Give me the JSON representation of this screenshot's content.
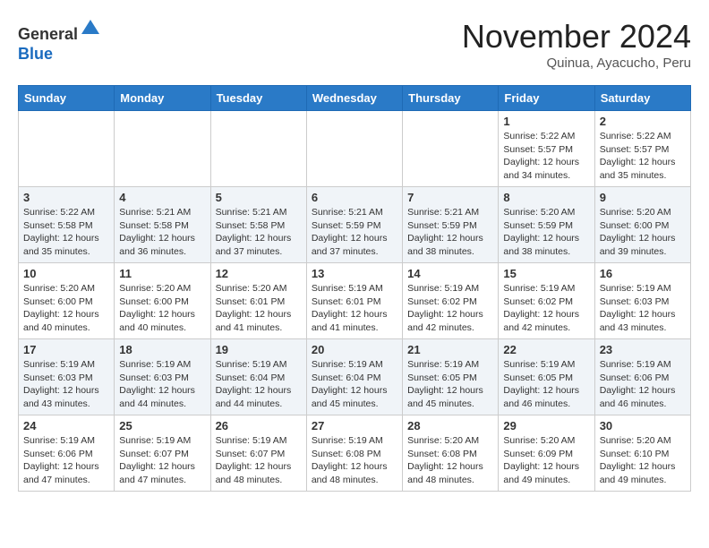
{
  "header": {
    "logo": {
      "line1": "General",
      "line2": "Blue"
    },
    "month": "November 2024",
    "location": "Quinua, Ayacucho, Peru"
  },
  "weekdays": [
    "Sunday",
    "Monday",
    "Tuesday",
    "Wednesday",
    "Thursday",
    "Friday",
    "Saturday"
  ],
  "weeks": [
    [
      {
        "day": "",
        "info": ""
      },
      {
        "day": "",
        "info": ""
      },
      {
        "day": "",
        "info": ""
      },
      {
        "day": "",
        "info": ""
      },
      {
        "day": "",
        "info": ""
      },
      {
        "day": "1",
        "info": "Sunrise: 5:22 AM\nSunset: 5:57 PM\nDaylight: 12 hours\nand 34 minutes."
      },
      {
        "day": "2",
        "info": "Sunrise: 5:22 AM\nSunset: 5:57 PM\nDaylight: 12 hours\nand 35 minutes."
      }
    ],
    [
      {
        "day": "3",
        "info": "Sunrise: 5:22 AM\nSunset: 5:58 PM\nDaylight: 12 hours\nand 35 minutes."
      },
      {
        "day": "4",
        "info": "Sunrise: 5:21 AM\nSunset: 5:58 PM\nDaylight: 12 hours\nand 36 minutes."
      },
      {
        "day": "5",
        "info": "Sunrise: 5:21 AM\nSunset: 5:58 PM\nDaylight: 12 hours\nand 37 minutes."
      },
      {
        "day": "6",
        "info": "Sunrise: 5:21 AM\nSunset: 5:59 PM\nDaylight: 12 hours\nand 37 minutes."
      },
      {
        "day": "7",
        "info": "Sunrise: 5:21 AM\nSunset: 5:59 PM\nDaylight: 12 hours\nand 38 minutes."
      },
      {
        "day": "8",
        "info": "Sunrise: 5:20 AM\nSunset: 5:59 PM\nDaylight: 12 hours\nand 38 minutes."
      },
      {
        "day": "9",
        "info": "Sunrise: 5:20 AM\nSunset: 6:00 PM\nDaylight: 12 hours\nand 39 minutes."
      }
    ],
    [
      {
        "day": "10",
        "info": "Sunrise: 5:20 AM\nSunset: 6:00 PM\nDaylight: 12 hours\nand 40 minutes."
      },
      {
        "day": "11",
        "info": "Sunrise: 5:20 AM\nSunset: 6:00 PM\nDaylight: 12 hours\nand 40 minutes."
      },
      {
        "day": "12",
        "info": "Sunrise: 5:20 AM\nSunset: 6:01 PM\nDaylight: 12 hours\nand 41 minutes."
      },
      {
        "day": "13",
        "info": "Sunrise: 5:19 AM\nSunset: 6:01 PM\nDaylight: 12 hours\nand 41 minutes."
      },
      {
        "day": "14",
        "info": "Sunrise: 5:19 AM\nSunset: 6:02 PM\nDaylight: 12 hours\nand 42 minutes."
      },
      {
        "day": "15",
        "info": "Sunrise: 5:19 AM\nSunset: 6:02 PM\nDaylight: 12 hours\nand 42 minutes."
      },
      {
        "day": "16",
        "info": "Sunrise: 5:19 AM\nSunset: 6:03 PM\nDaylight: 12 hours\nand 43 minutes."
      }
    ],
    [
      {
        "day": "17",
        "info": "Sunrise: 5:19 AM\nSunset: 6:03 PM\nDaylight: 12 hours\nand 43 minutes."
      },
      {
        "day": "18",
        "info": "Sunrise: 5:19 AM\nSunset: 6:03 PM\nDaylight: 12 hours\nand 44 minutes."
      },
      {
        "day": "19",
        "info": "Sunrise: 5:19 AM\nSunset: 6:04 PM\nDaylight: 12 hours\nand 44 minutes."
      },
      {
        "day": "20",
        "info": "Sunrise: 5:19 AM\nSunset: 6:04 PM\nDaylight: 12 hours\nand 45 minutes."
      },
      {
        "day": "21",
        "info": "Sunrise: 5:19 AM\nSunset: 6:05 PM\nDaylight: 12 hours\nand 45 minutes."
      },
      {
        "day": "22",
        "info": "Sunrise: 5:19 AM\nSunset: 6:05 PM\nDaylight: 12 hours\nand 46 minutes."
      },
      {
        "day": "23",
        "info": "Sunrise: 5:19 AM\nSunset: 6:06 PM\nDaylight: 12 hours\nand 46 minutes."
      }
    ],
    [
      {
        "day": "24",
        "info": "Sunrise: 5:19 AM\nSunset: 6:06 PM\nDaylight: 12 hours\nand 47 minutes."
      },
      {
        "day": "25",
        "info": "Sunrise: 5:19 AM\nSunset: 6:07 PM\nDaylight: 12 hours\nand 47 minutes."
      },
      {
        "day": "26",
        "info": "Sunrise: 5:19 AM\nSunset: 6:07 PM\nDaylight: 12 hours\nand 48 minutes."
      },
      {
        "day": "27",
        "info": "Sunrise: 5:19 AM\nSunset: 6:08 PM\nDaylight: 12 hours\nand 48 minutes."
      },
      {
        "day": "28",
        "info": "Sunrise: 5:20 AM\nSunset: 6:08 PM\nDaylight: 12 hours\nand 48 minutes."
      },
      {
        "day": "29",
        "info": "Sunrise: 5:20 AM\nSunset: 6:09 PM\nDaylight: 12 hours\nand 49 minutes."
      },
      {
        "day": "30",
        "info": "Sunrise: 5:20 AM\nSunset: 6:10 PM\nDaylight: 12 hours\nand 49 minutes."
      }
    ]
  ]
}
